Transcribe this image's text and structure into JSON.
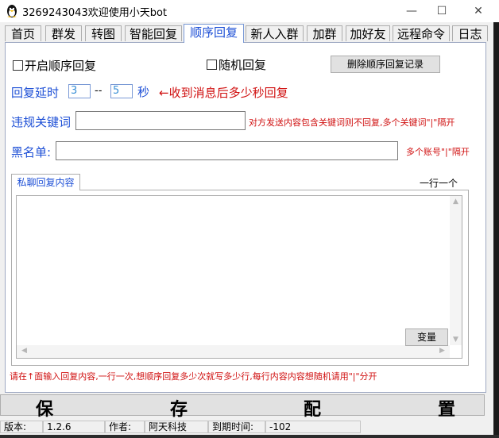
{
  "window": {
    "title": "3269243043欢迎使用小天bot",
    "controls": {
      "minimize": "—",
      "maximize": "☐",
      "close": "✕"
    }
  },
  "tabs": [
    {
      "label": "首页",
      "active": false
    },
    {
      "label": "群发",
      "active": false
    },
    {
      "label": "转图",
      "active": false
    },
    {
      "label": "智能回复",
      "active": false
    },
    {
      "label": "顺序回复",
      "active": true
    },
    {
      "label": "新人入群",
      "active": false
    },
    {
      "label": "加群",
      "active": false
    },
    {
      "label": "加好友",
      "active": false
    },
    {
      "label": "远程命令",
      "active": false
    },
    {
      "label": "日志",
      "active": false
    }
  ],
  "options": {
    "enable_sequential": {
      "label": "开启顺序回复",
      "checked": false
    },
    "random_reply": {
      "label": "随机回复",
      "checked": false
    },
    "delete_records_button": "删除顺序回复记录"
  },
  "delay": {
    "label": "回复延时",
    "min": "3",
    "separator": "--",
    "max": "5",
    "unit": "秒",
    "hint": "←收到消息后多少秒回复"
  },
  "keywords": {
    "label": "违规关键词",
    "value": "",
    "hint": "对方发送内容包含关键词则不回复,多个关键词\"|\"隔开"
  },
  "blacklist": {
    "label": "黑名单:",
    "value": "",
    "hint": "多个账号\"|\"隔开"
  },
  "private_reply": {
    "tab_label": "私聊回复内容",
    "right_label": "一行一个",
    "content": "",
    "variable_button": "变量"
  },
  "footer_hint": "请在↑面输入回复内容,一行一次,想顺序回复多少次就写多少行,每行内容内容想随机请用\"|\"分开",
  "save_button": {
    "chars": [
      "保",
      "存",
      "配",
      "置"
    ]
  },
  "status": {
    "version_label": "版本:",
    "version": "1.2.6",
    "author_label": "作者:",
    "author": "阿天科技",
    "expire_label": "到期时间:",
    "expire": "-102"
  },
  "colors": {
    "accent_blue": "#1d4fd6",
    "hint_red": "#d01010"
  }
}
